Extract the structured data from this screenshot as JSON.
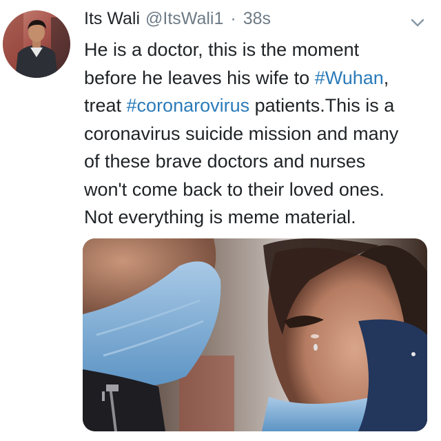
{
  "tweet": {
    "author": {
      "display_name": "Its Wali",
      "handle": "@ItsWali1"
    },
    "separator": "·",
    "timestamp": "38s",
    "menu_icon": "chevron-down-icon",
    "text_lines": [
      {
        "segments": [
          {
            "text": "He is a doctor, this is the moment",
            "hashtag": false
          }
        ]
      },
      {
        "segments": [
          {
            "text": "before he leaves his wife to ",
            "hashtag": false
          },
          {
            "text": "#Wuhan",
            "hashtag": true
          },
          {
            "text": ",",
            "hashtag": false
          }
        ]
      },
      {
        "segments": [
          {
            "text": "treat ",
            "hashtag": false
          },
          {
            "text": "#coronarovirus",
            "hashtag": true
          },
          {
            "text": " patients.This is a",
            "hashtag": false
          }
        ]
      },
      {
        "segments": [
          {
            "text": "coronavirus suicide mission and many",
            "hashtag": false
          }
        ]
      },
      {
        "segments": [
          {
            "text": "of these brave doctors and nurses",
            "hashtag": false
          }
        ]
      },
      {
        "segments": [
          {
            "text": "won't come back to their loved ones.",
            "hashtag": false
          }
        ]
      },
      {
        "segments": [
          {
            "text": "Not everything is meme material.",
            "hashtag": false
          }
        ]
      }
    ],
    "colors": {
      "hashtag": "#2b7bb9",
      "secondary_text": "#6e7b86",
      "primary_text": "#1f2326"
    }
  }
}
